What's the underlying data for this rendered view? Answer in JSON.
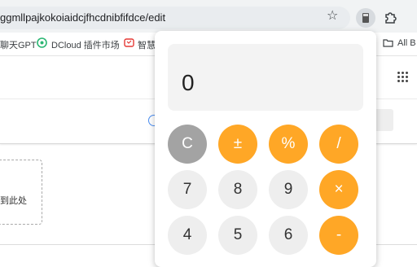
{
  "browser": {
    "url": "ggmllpajkokoiaidcjfhcdnibfifdce/edit",
    "bookmarks": [
      {
        "label": "聊天GPT"
      },
      {
        "label": "DCloud 插件市场"
      },
      {
        "label": "智慧"
      },
      {
        "label": "All B"
      }
    ]
  },
  "page": {
    "dropzone_text": "到此处"
  },
  "calculator": {
    "display": "0",
    "keys": {
      "clear": "C",
      "sign": "±",
      "percent": "%",
      "divide": "/",
      "seven": "7",
      "eight": "8",
      "nine": "9",
      "multiply": "×",
      "four": "4",
      "five": "5",
      "six": "6",
      "minus": "-"
    },
    "colors": {
      "operator": "#ffa726",
      "function": "#a3a3a3",
      "digit": "#eeeeee"
    }
  }
}
